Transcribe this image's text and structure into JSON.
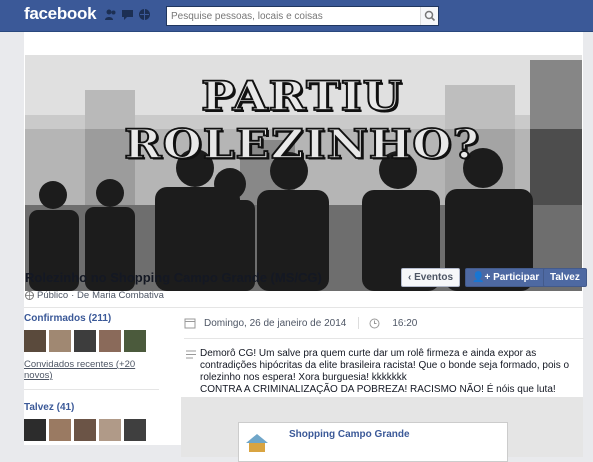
{
  "header": {
    "logo": "facebook",
    "search_placeholder": "Pesquise pessoas, locais e coisas"
  },
  "cover": {
    "headline": "PARTIU ROLEZINHO?"
  },
  "event": {
    "title": "Rolezinho no Shopping Campo Grande (MS/CG)",
    "privacy": "Público",
    "host_prefix": "· De",
    "host": "Maria Combativa",
    "buttons": {
      "events": "Eventos",
      "join": "Participar",
      "maybe": "Talvez"
    },
    "date": "Domingo, 26 de janeiro de 2014",
    "time": "16:20",
    "description": [
      "Demorô CG! Um salve pra quem curte dar um rolê firmeza e ainda expor as",
      "contradições hipócritas da elite brasileira racista! Que o bonde seja formado, pois o",
      "rolezinho nos espera! Xora burguesia! kkkkkkk",
      "CONTRA A CRIMINALIZAÇÃO DA POBREZA! RACISMO NÃO! É nóis que luta!"
    ],
    "place_name": "Shopping Campo Grande"
  },
  "sidebar": {
    "confirmed_label": "Confirmados (211)",
    "recent_invited": "Convidados recentes (+20 novos)",
    "maybe_label": "Talvez (41)"
  },
  "colors": {
    "brand": "#3b5998",
    "link": "#3b5998",
    "button_blue": "#4e69a2"
  }
}
